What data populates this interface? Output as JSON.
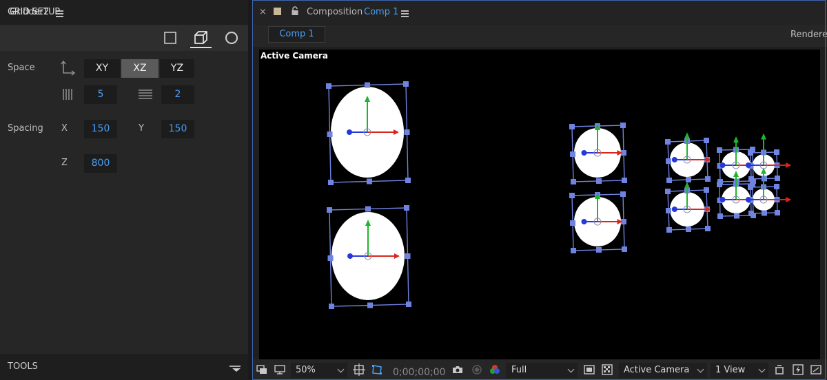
{
  "left_panel": {
    "title": "Gridder2",
    "section_title": "GRID SETUP",
    "mode_icons": [
      "square-icon",
      "cube-icon",
      "circle-icon"
    ],
    "space": {
      "label": "Space",
      "planes": [
        "XY",
        "XZ",
        "YZ"
      ],
      "selected_plane": "XZ",
      "columns_value": "5",
      "rows_value": "2"
    },
    "spacing": {
      "label": "Spacing",
      "x_label": "X",
      "x_value": "150",
      "y_label": "Y",
      "y_value": "150",
      "z_label": "Z",
      "z_value": "800"
    },
    "tools_label": "TOOLS"
  },
  "composition": {
    "panel_label": "Composition",
    "comp_name": "Comp 1",
    "tab_label": "Comp 1",
    "renderer_label": "Rendere",
    "viewer_label": "Active Camera"
  },
  "bottom_toolbar": {
    "zoom": "50%",
    "timecode": "0;00;00;00",
    "resolution": "Full",
    "camera_view": "Active Camera",
    "views": "1 View"
  },
  "colors": {
    "accent_blue": "#4a9ff5",
    "selection_blue": "#6f83e0",
    "x_axis": "#d9261c",
    "y_axis": "#1fb52a",
    "z_axis": "#2838d8"
  }
}
